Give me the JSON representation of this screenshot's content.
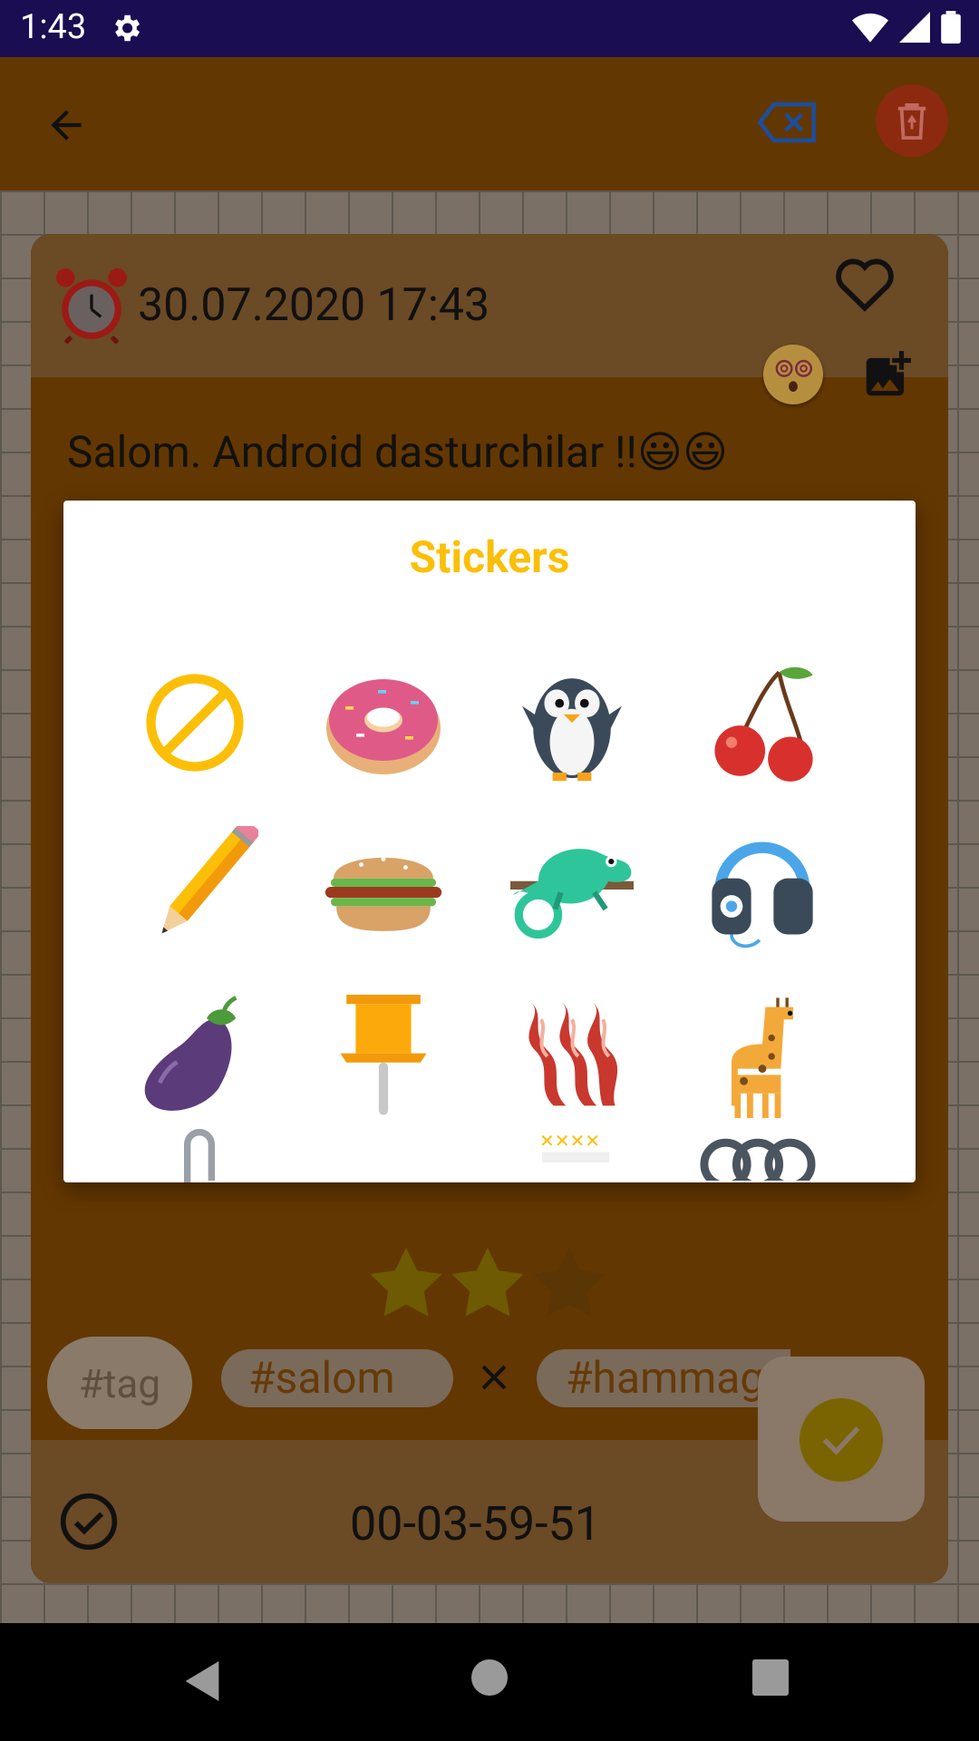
{
  "status_bar": {
    "time": "1:43"
  },
  "note": {
    "date": "30.07.2020 17:43",
    "text": "Salom. Android dasturchilar !!😃😃",
    "rating": {
      "filled": 2,
      "total": 3
    },
    "tags": {
      "input_placeholder": "#tag",
      "chips": [
        "#salom",
        "#hammag"
      ]
    },
    "timer": "00-03-59-51"
  },
  "dialog": {
    "title": "Stickers",
    "stickers": [
      "none-icon",
      "donut-icon",
      "penguin-icon",
      "cherry-icon",
      "pencil-icon",
      "burger-icon",
      "chameleon-icon",
      "headphones-icon",
      "eggplant-icon",
      "pushpin-icon",
      "bacon-icon",
      "giraffe-icon"
    ]
  },
  "colors": {
    "accent": "#fcbf07",
    "app_bar": "#633701",
    "status_bar": "#1a0d52"
  }
}
